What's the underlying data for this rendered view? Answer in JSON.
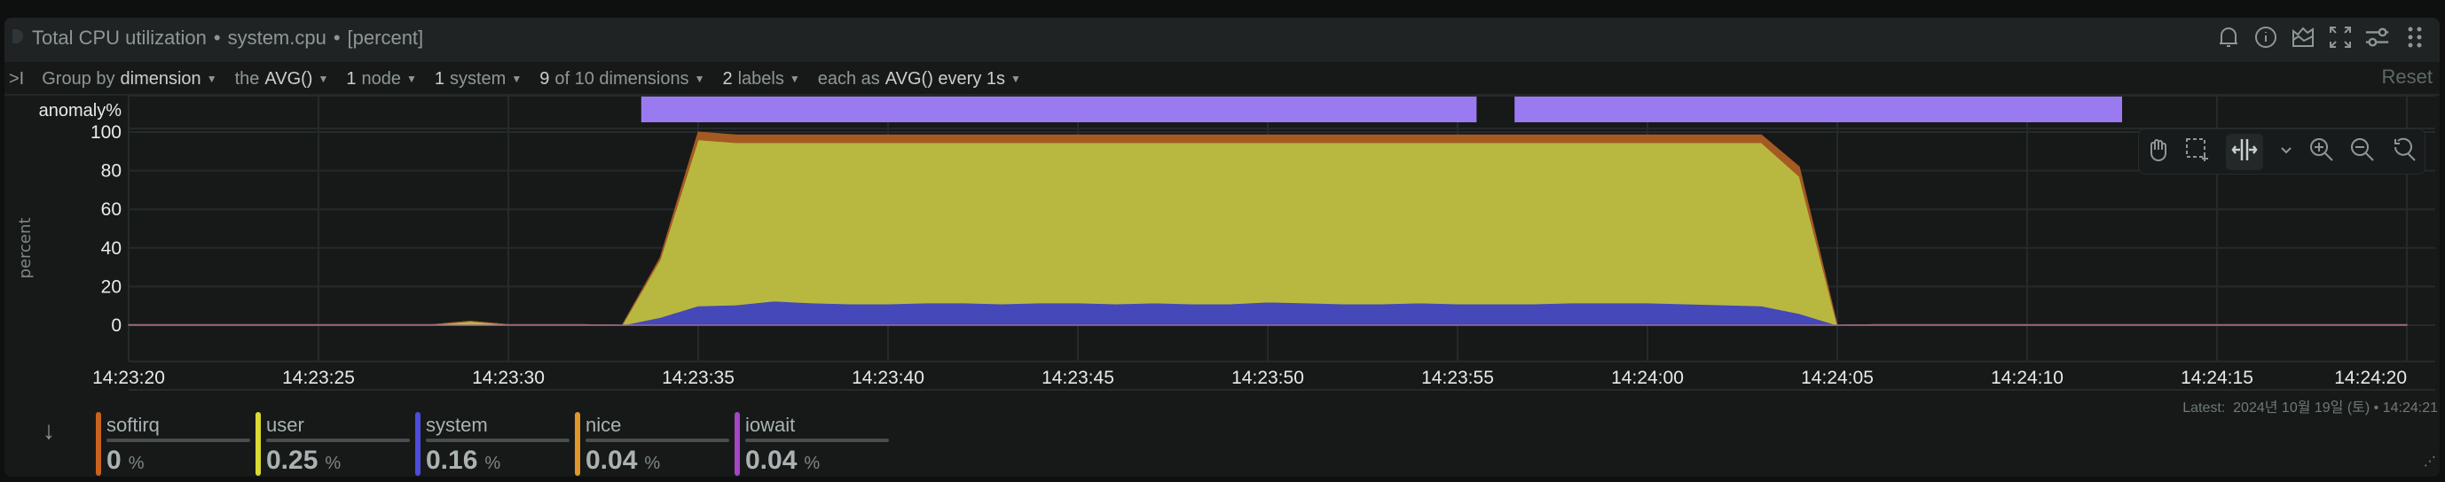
{
  "header": {
    "title": "Total CPU utilization",
    "context": "system.cpu",
    "units": "[percent]",
    "icons": [
      "bell-icon",
      "info-icon",
      "anomaly-icon",
      "fullscreen-icon",
      "settings-sliders-icon",
      "drag-dots-icon"
    ]
  },
  "toolbar": {
    "toggle": ">I",
    "group_by_label": "Group by",
    "group_by_value": "dimension",
    "agg_label": "the",
    "agg_value": "AVG()",
    "nodes_count": "1",
    "nodes_label": "node",
    "systems_count": "1",
    "systems_label": "system",
    "dims_value": "9",
    "dims_label": "of 10 dimensions",
    "labels_count": "2",
    "labels_label": "labels",
    "each_label": "each as",
    "each_value": "AVG() every 1s",
    "reset": "Reset"
  },
  "colors": {
    "softirq": "#c8621d",
    "user": "#d9d932",
    "system": "#4c4cdc",
    "nice": "#e0962a",
    "iowait": "#a445c4",
    "anomaly": "#9a7af0"
  },
  "chart_data": {
    "type": "area",
    "stacked": true,
    "ylabel": "percent",
    "anomaly_label": "anomaly%",
    "ylim": [
      -20,
      100
    ],
    "yticks": [
      0,
      20,
      40,
      60,
      80,
      100
    ],
    "xtick_labels": [
      "14:23:20",
      "14:23:25",
      "14:23:30",
      "14:23:35",
      "14:23:40",
      "14:23:45",
      "14:23:50",
      "14:23:55",
      "14:24:00",
      "14:24:05",
      "14:24:10",
      "14:24:15",
      "14:24:20"
    ],
    "x_start": "14:23:20",
    "x_step_seconds": 1,
    "x_range_seconds": [
      0,
      60
    ],
    "anomaly_ranges_seconds": [
      [
        13.5,
        35.5
      ],
      [
        36.5,
        52.5
      ]
    ],
    "series": [
      {
        "name": "system",
        "color": "#4448b8",
        "values": [
          0.1,
          0.1,
          0.1,
          0.1,
          0.1,
          0.1,
          0.1,
          0.1,
          0.1,
          0.5,
          0.1,
          0.1,
          0.1,
          0,
          4,
          10,
          10.5,
          12.5,
          11.5,
          11,
          11,
          11.5,
          11.5,
          11,
          11.5,
          11.5,
          11,
          11.5,
          11,
          11,
          12,
          11.5,
          11,
          11,
          11.5,
          11,
          11,
          11,
          11.5,
          11.5,
          11.5,
          11,
          10.5,
          10,
          6,
          0,
          0.1,
          0.1,
          0.1,
          0.1,
          0.1,
          0.1,
          0.1,
          0.1,
          0.1,
          0.1,
          0.1,
          0.1,
          0.1,
          0.1,
          0.1
        ]
      },
      {
        "name": "user",
        "color": "#b8b840",
        "values": [
          0.2,
          0.2,
          0.2,
          0.2,
          0.2,
          0.2,
          0.2,
          0.2,
          0.2,
          1.5,
          0.2,
          0.2,
          0.2,
          0,
          30,
          86,
          84,
          82,
          83,
          83.5,
          83.5,
          83,
          83,
          83.5,
          83,
          83,
          83.5,
          83,
          83.5,
          83.5,
          82.5,
          83,
          83.5,
          83.5,
          83,
          83.5,
          83.5,
          83.5,
          83,
          83,
          83,
          83.5,
          84,
          84.5,
          71,
          0,
          0.2,
          0.2,
          0.2,
          0.2,
          0.2,
          0.2,
          0.2,
          0.2,
          0.2,
          0.2,
          0.2,
          0.2,
          0.2,
          0.2,
          0.2
        ]
      },
      {
        "name": "softirq",
        "color": "#a55a22",
        "values": [
          0,
          0,
          0,
          0,
          0,
          0,
          0,
          0,
          0,
          0,
          0,
          0,
          0,
          0,
          1,
          4,
          4,
          4,
          4,
          4,
          4,
          4,
          4,
          4,
          4,
          4,
          4,
          4,
          4,
          4,
          4,
          4,
          4,
          4,
          4,
          4,
          4,
          4,
          4,
          4,
          4,
          4,
          4,
          4,
          5,
          0,
          0,
          0,
          0,
          0,
          0,
          0,
          0,
          0,
          0,
          0,
          0,
          0,
          0,
          0,
          0
        ]
      }
    ],
    "latest_label": "Latest:",
    "latest_value": "2024년 10월 19일 (토) • 14:24:21"
  },
  "chart_tools": [
    "pan-hand-icon",
    "select-zoom-icon",
    "horizontal-zoom-icon",
    "chevron-down-icon",
    "zoom-in-icon",
    "zoom-out-icon",
    "reset-zoom-icon"
  ],
  "legend": [
    {
      "name": "softirq",
      "value": "0",
      "unit": "%",
      "color": "#c8621d"
    },
    {
      "name": "user",
      "value": "0.25",
      "unit": "%",
      "color": "#d9d932"
    },
    {
      "name": "system",
      "value": "0.16",
      "unit": "%",
      "color": "#4c4cdc"
    },
    {
      "name": "nice",
      "value": "0.04",
      "unit": "%",
      "color": "#e0962a"
    },
    {
      "name": "iowait",
      "value": "0.04",
      "unit": "%",
      "color": "#a445c4"
    }
  ]
}
